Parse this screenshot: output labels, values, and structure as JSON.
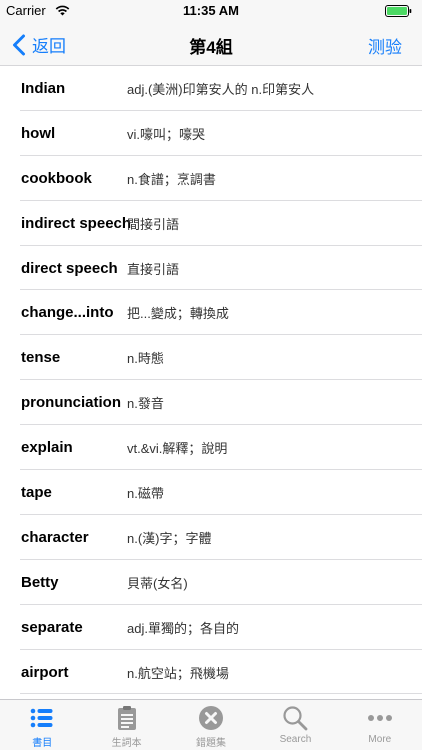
{
  "status_bar": {
    "carrier": "Carrier",
    "time": "11:35 AM"
  },
  "nav": {
    "back_label": "返回",
    "title": "第4組",
    "right_label": "测验"
  },
  "words": [
    {
      "term": "Indian",
      "definition": "adj.(美洲)印第安人的 n.印第安人"
    },
    {
      "term": "howl",
      "definition": "vi.嚎叫；嚎哭"
    },
    {
      "term": "cookbook",
      "definition": "n.食譜；烹調書"
    },
    {
      "term": "indirect speech",
      "definition": "間接引語"
    },
    {
      "term": "direct speech",
      "definition": "直接引語"
    },
    {
      "term": "change...into",
      "definition": "把...變成；轉換成"
    },
    {
      "term": "tense",
      "definition": "n.時態"
    },
    {
      "term": "pronunciation",
      "definition": "n.發音"
    },
    {
      "term": "explain",
      "definition": "vt.&vi.解釋；說明"
    },
    {
      "term": "tape",
      "definition": "n.磁帶"
    },
    {
      "term": "character",
      "definition": "n.(漢)字；字體"
    },
    {
      "term": "Betty",
      "definition": "貝蒂(女名)"
    },
    {
      "term": "separate",
      "definition": "adj.單獨的；各自的"
    },
    {
      "term": "airport",
      "definition": "n.航空站；飛機場"
    }
  ],
  "tabs": [
    {
      "label": "書目",
      "icon": "list-icon",
      "active": true
    },
    {
      "label": "生詞本",
      "icon": "clipboard-icon",
      "active": false
    },
    {
      "label": "錯題集",
      "icon": "x-circle-icon",
      "active": false
    },
    {
      "label": "Search",
      "icon": "search-icon",
      "active": false
    },
    {
      "label": "More",
      "icon": "more-icon",
      "active": false
    }
  ],
  "colors": {
    "accent": "#157efb",
    "inactive": "#999999",
    "bar_bg": "#f7f7f7",
    "battery": "#4cd964"
  }
}
